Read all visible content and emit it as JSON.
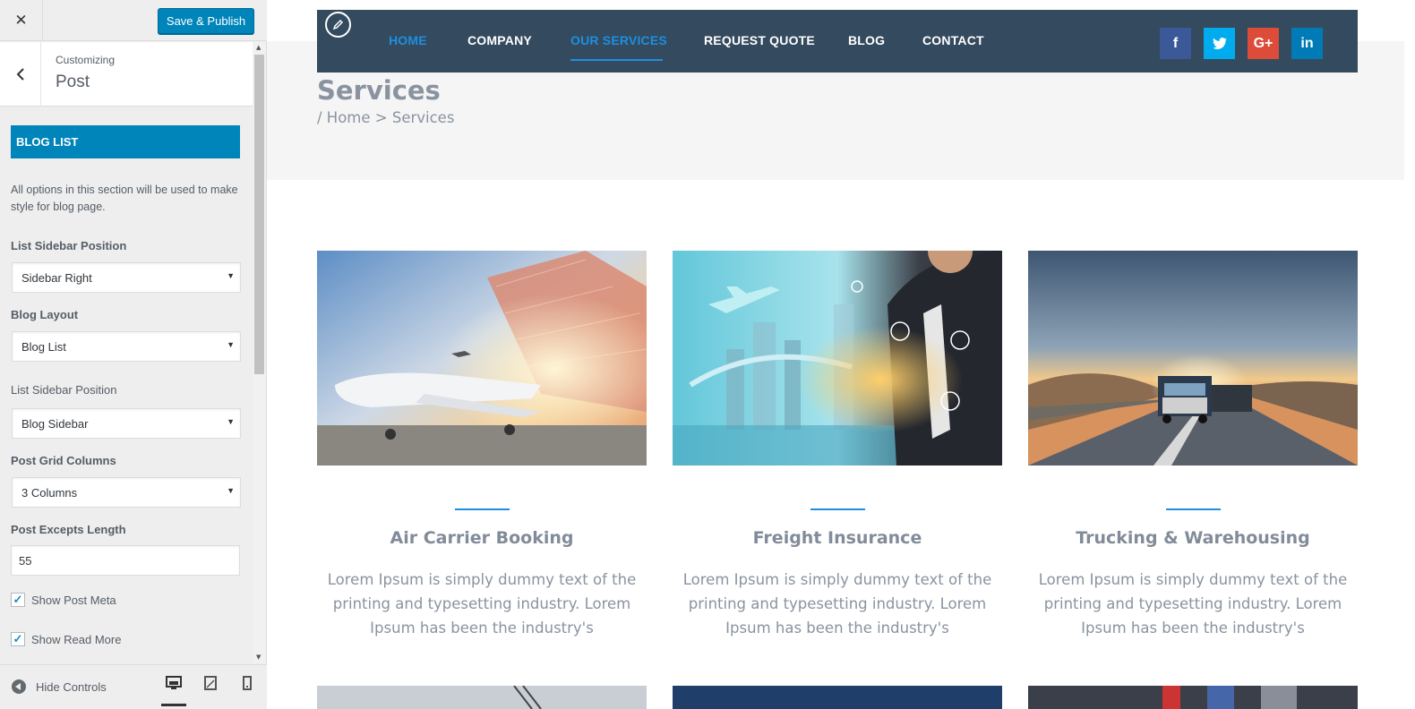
{
  "customizer": {
    "close_icon": "close-icon",
    "publish_label": "Save & Publish",
    "customizing_label": "Customizing",
    "section_title": "Post",
    "panel_title": "BLOG LIST",
    "description": "All options in this section will be used to make style for blog page.",
    "controls": {
      "list_sidebar_position": {
        "label": "List Sidebar Position",
        "value": "Sidebar Right"
      },
      "blog_layout": {
        "label": "Blog Layout",
        "value": "Blog List"
      },
      "list_sidebar_position_2": {
        "label": "List Sidebar Position",
        "value": "Blog Sidebar"
      },
      "post_grid_columns": {
        "label": "Post Grid Columns",
        "value": "3 Columns"
      },
      "post_excerpt_length": {
        "label": "Post Excepts Length",
        "value": "55"
      },
      "show_post_meta": {
        "label": "Show Post Meta",
        "checked": true
      },
      "show_read_more": {
        "label": "Show Read More",
        "checked": true
      }
    },
    "footer": {
      "hide_controls_label": "Hide Controls",
      "devices": [
        "desktop",
        "tablet",
        "mobile"
      ],
      "active_device": "desktop"
    }
  },
  "site": {
    "nav": {
      "items": [
        "HOME",
        "COMPANY",
        "OUR SERVICES",
        "REQUEST QUOTE",
        "BLOG",
        "CONTACT"
      ],
      "active": "OUR SERVICES",
      "social": [
        {
          "name": "facebook",
          "glyph": "f",
          "color": "#3b5998"
        },
        {
          "name": "twitter",
          "glyph": "t",
          "color": "#00aced"
        },
        {
          "name": "google-plus",
          "glyph": "G+",
          "color": "#dd4b39"
        },
        {
          "name": "linkedin",
          "glyph": "in",
          "color": "#007bb6"
        }
      ]
    },
    "page_title": "Services",
    "breadcrumb": "/ Home > Services",
    "services": [
      {
        "title": "Air Carrier Booking",
        "text": "Lorem Ipsum is simply dummy text of the printing and typesetting industry. Lorem Ipsum has been the industry's"
      },
      {
        "title": "Freight Insurance",
        "text": "Lorem Ipsum is simply dummy text of the printing and typesetting industry. Lorem Ipsum has been the industry's"
      },
      {
        "title": "Trucking & Warehousing",
        "text": "Lorem Ipsum is simply dummy text of the printing and typesetting industry. Lorem Ipsum has been the industry's"
      }
    ],
    "colors": {
      "nav_bg": "#344a5e",
      "accent": "#1d8fe1",
      "wp_blue": "#0085ba"
    }
  }
}
